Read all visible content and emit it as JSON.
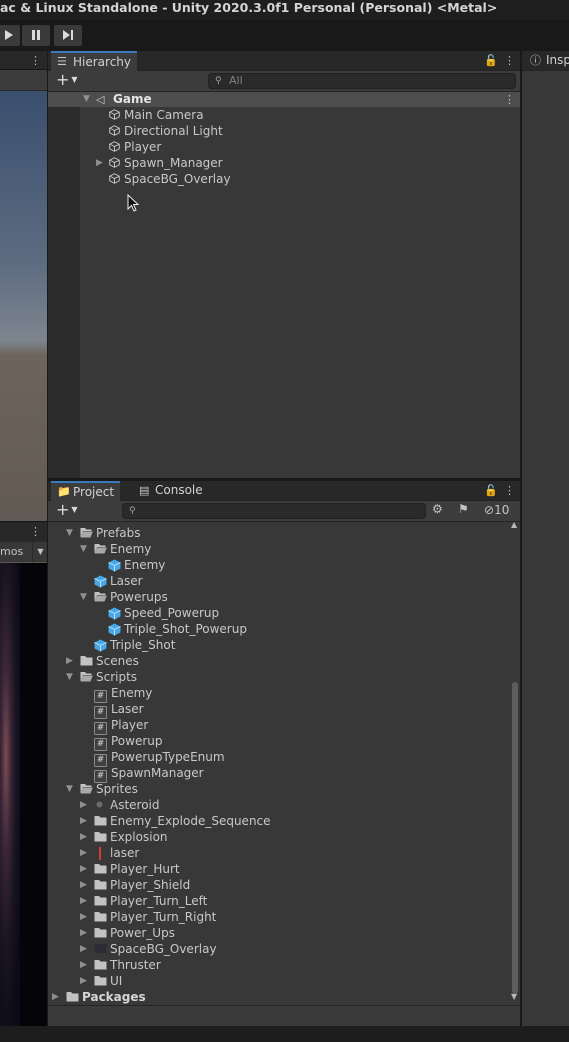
{
  "window": {
    "title": "ac & Linux Standalone - Unity 2020.3.0f1 Personal (Personal) <Metal>"
  },
  "toolbar": {
    "play_icon": "play-icon",
    "pause_icon": "pause-icon",
    "step_icon": "step-icon"
  },
  "game_view": {
    "gizmos_label": "mos"
  },
  "hierarchy": {
    "tab_label": "Hierarchy",
    "search_placeholder": "All",
    "scene_name": "Game",
    "objects": [
      {
        "label": "Main Camera",
        "expandable": false
      },
      {
        "label": "Directional Light",
        "expandable": false
      },
      {
        "label": "Player",
        "expandable": false
      },
      {
        "label": "Spawn_Manager",
        "expandable": true
      },
      {
        "label": "SpaceBG_Overlay",
        "expandable": false
      }
    ]
  },
  "inspector": {
    "tab_label": "Insp"
  },
  "project": {
    "tabs": [
      {
        "label": "Project"
      },
      {
        "label": "Console"
      }
    ],
    "search_placeholder": "",
    "hidden_count": "10",
    "items": [
      {
        "label": "Prefabs",
        "icon": "folder-open",
        "depth": 1,
        "arrow": "down"
      },
      {
        "label": "Enemy",
        "icon": "folder-open",
        "depth": 2,
        "arrow": "down"
      },
      {
        "label": "Enemy",
        "icon": "prefab",
        "depth": 3,
        "arrow": "none"
      },
      {
        "label": "Laser",
        "icon": "prefab",
        "depth": 2,
        "arrow": "none"
      },
      {
        "label": "Powerups",
        "icon": "folder-open",
        "depth": 2,
        "arrow": "down"
      },
      {
        "label": "Speed_Powerup",
        "icon": "prefab",
        "depth": 3,
        "arrow": "none"
      },
      {
        "label": "Triple_Shot_Powerup",
        "icon": "prefab",
        "depth": 3,
        "arrow": "none"
      },
      {
        "label": "Triple_Shot",
        "icon": "prefab",
        "depth": 2,
        "arrow": "none"
      },
      {
        "label": "Scenes",
        "icon": "folder",
        "depth": 1,
        "arrow": "right"
      },
      {
        "label": "Scripts",
        "icon": "folder-open",
        "depth": 1,
        "arrow": "down"
      },
      {
        "label": "Enemy",
        "icon": "script",
        "depth": 2,
        "arrow": "none"
      },
      {
        "label": "Laser",
        "icon": "script",
        "depth": 2,
        "arrow": "none"
      },
      {
        "label": "Player",
        "icon": "script",
        "depth": 2,
        "arrow": "none"
      },
      {
        "label": "Powerup",
        "icon": "script",
        "depth": 2,
        "arrow": "none"
      },
      {
        "label": "PowerupTypeEnum",
        "icon": "script",
        "depth": 2,
        "arrow": "none"
      },
      {
        "label": "SpawnManager",
        "icon": "script",
        "depth": 2,
        "arrow": "none"
      },
      {
        "label": "Sprites",
        "icon": "folder-open",
        "depth": 1,
        "arrow": "down"
      },
      {
        "label": "Asteroid",
        "icon": "sprite-asteroid",
        "depth": 2,
        "arrow": "right"
      },
      {
        "label": "Enemy_Explode_Sequence",
        "icon": "folder",
        "depth": 2,
        "arrow": "right"
      },
      {
        "label": "Explosion",
        "icon": "folder",
        "depth": 2,
        "arrow": "right"
      },
      {
        "label": "laser",
        "icon": "sprite-laser",
        "depth": 2,
        "arrow": "right"
      },
      {
        "label": "Player_Hurt",
        "icon": "folder",
        "depth": 2,
        "arrow": "right"
      },
      {
        "label": "Player_Shield",
        "icon": "folder",
        "depth": 2,
        "arrow": "right"
      },
      {
        "label": "Player_Turn_Left",
        "icon": "folder",
        "depth": 2,
        "arrow": "right"
      },
      {
        "label": "Player_Turn_Right",
        "icon": "folder",
        "depth": 2,
        "arrow": "right"
      },
      {
        "label": "Power_Ups",
        "icon": "folder",
        "depth": 2,
        "arrow": "right"
      },
      {
        "label": "SpaceBG_Overlay",
        "icon": "sprite-bg",
        "depth": 2,
        "arrow": "right"
      },
      {
        "label": "Thruster",
        "icon": "folder",
        "depth": 2,
        "arrow": "right"
      },
      {
        "label": "UI",
        "icon": "folder",
        "depth": 2,
        "arrow": "right"
      },
      {
        "label": "Packages",
        "icon": "folder",
        "depth": 0,
        "arrow": "right",
        "bold": true
      }
    ]
  }
}
